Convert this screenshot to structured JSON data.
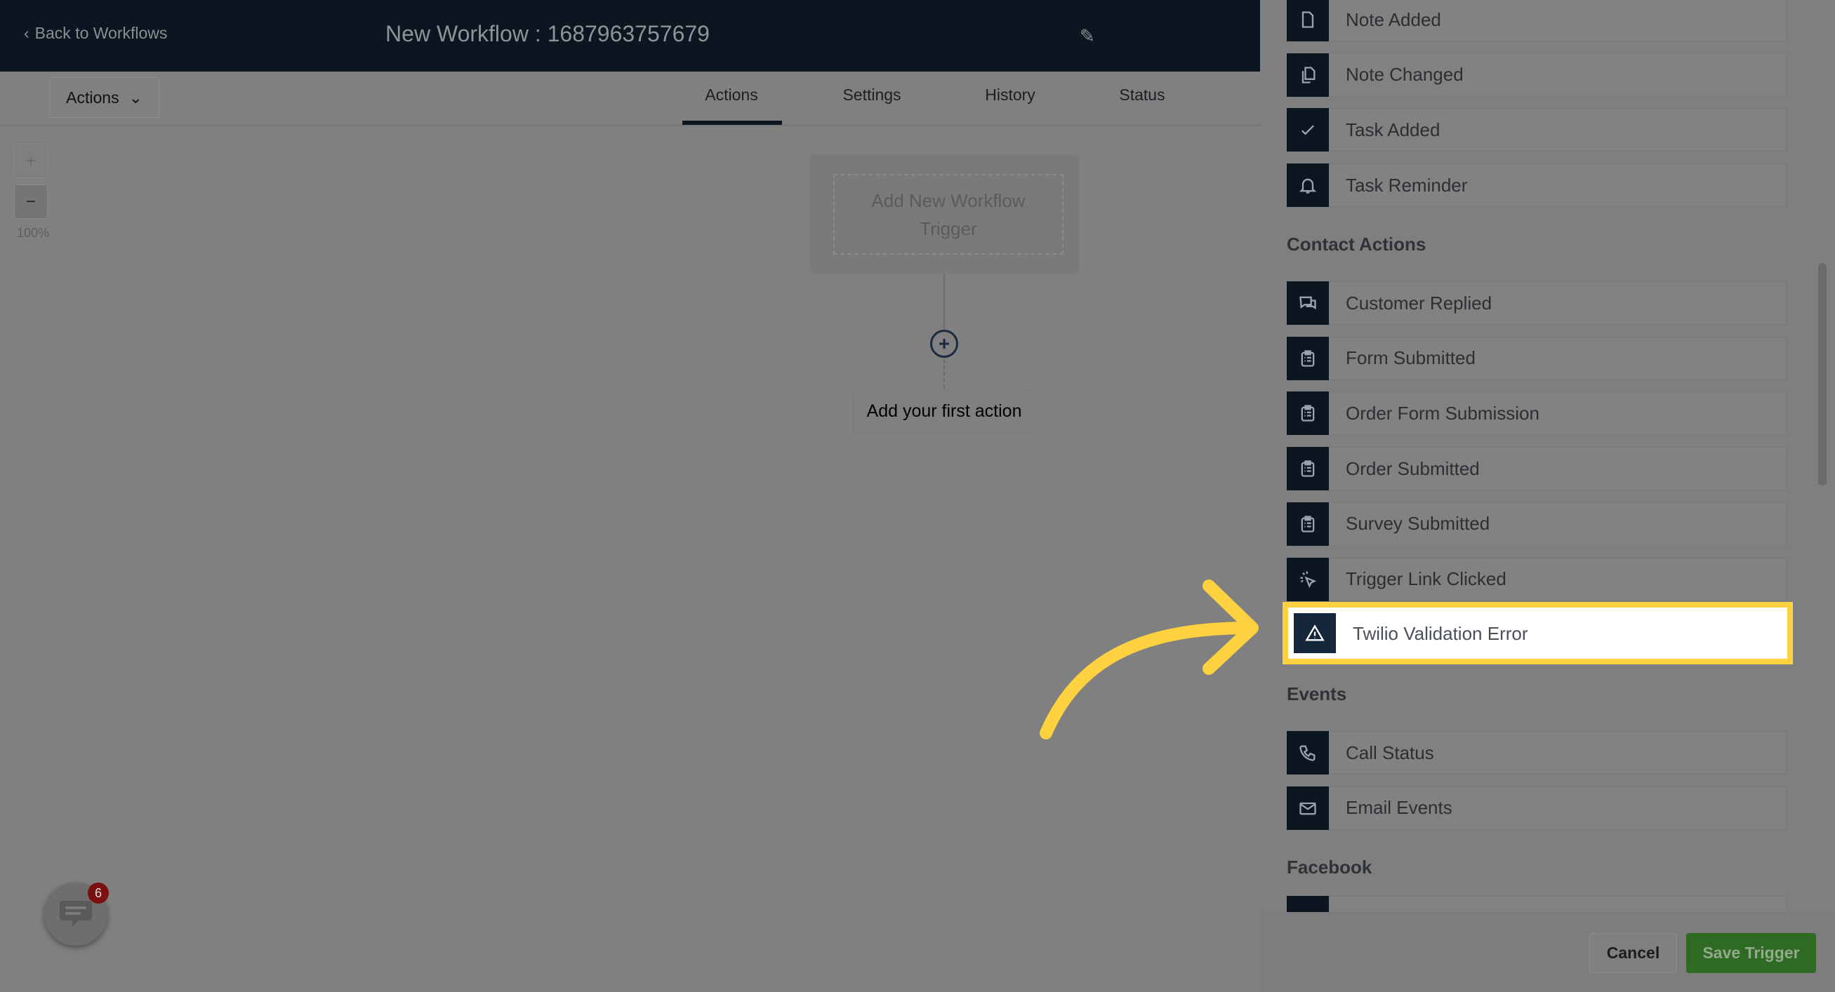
{
  "header": {
    "back_label": "Back to Workflows",
    "title": "New Workflow : 1687963757679"
  },
  "toolbar": {
    "actions_dropdown": "Actions",
    "tabs": [
      "Actions",
      "Settings",
      "History",
      "Status"
    ],
    "active_tab": "Actions"
  },
  "canvas": {
    "zoom_in": "+",
    "zoom_out": "−",
    "zoom_level": "100%",
    "trigger_placeholder": "Add New Workflow Trigger",
    "first_action": "Add your first action"
  },
  "chat": {
    "badge_count": "6"
  },
  "panel": {
    "items_top": [
      {
        "label": "Note Added",
        "icon": "file-icon"
      },
      {
        "label": "Note Changed",
        "icon": "files-icon"
      },
      {
        "label": "Task Added",
        "icon": "check-icon"
      },
      {
        "label": "Task Reminder",
        "icon": "bell-icon"
      }
    ],
    "contact_heading": "Contact Actions",
    "contact_items": [
      {
        "label": "Customer Replied",
        "icon": "chat-icon"
      },
      {
        "label": "Form Submitted",
        "icon": "clipboard-icon"
      },
      {
        "label": "Order Form Submission",
        "icon": "clipboard-icon"
      },
      {
        "label": "Order Submitted",
        "icon": "clipboard-icon"
      },
      {
        "label": "Survey Submitted",
        "icon": "clipboard-icon"
      },
      {
        "label": "Trigger Link Clicked",
        "icon": "cursor-click-icon"
      }
    ],
    "highlighted": {
      "label": "Twilio Validation Error",
      "icon": "warning-icon"
    },
    "events_heading": "Events",
    "events_items": [
      {
        "label": "Call Status",
        "icon": "phone-icon"
      },
      {
        "label": "Email Events",
        "icon": "mail-icon"
      }
    ],
    "facebook_heading": "Facebook"
  },
  "footer": {
    "cancel": "Cancel",
    "save": "Save Trigger"
  },
  "colors": {
    "highlight": "#fdd13f",
    "save": "#2e6a23",
    "header": "#0b1620"
  }
}
